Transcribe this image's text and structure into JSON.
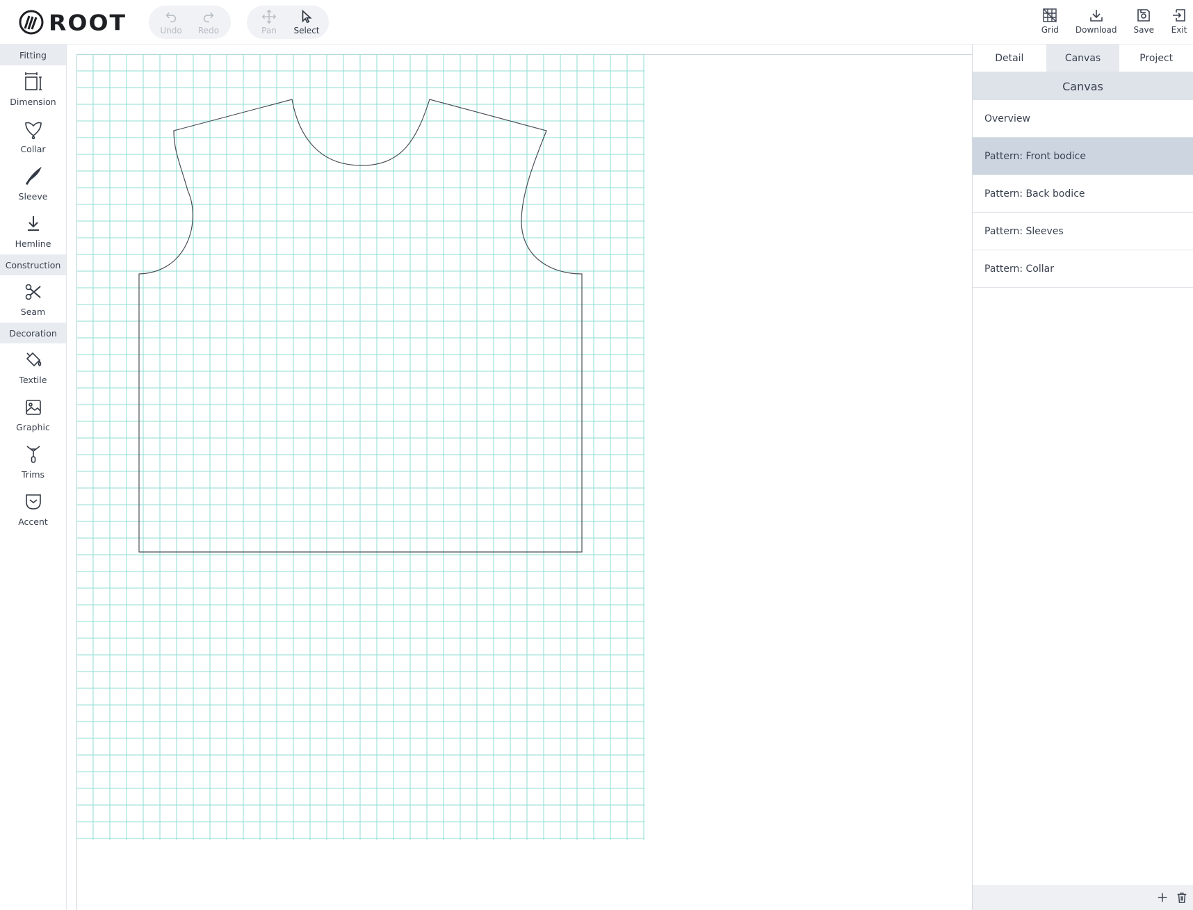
{
  "app": {
    "logo_text": "ROOT"
  },
  "toolbar": {
    "undo_label": "Undo",
    "redo_label": "Redo",
    "pan_label": "Pan",
    "select_label": "Select",
    "grid_label": "Grid",
    "download_label": "Download",
    "save_label": "Save",
    "exit_label": "Exit"
  },
  "sidebar": {
    "sections": [
      {
        "title": "Fitting",
        "items": [
          {
            "label": "Dimension",
            "icon": "dimension-icon"
          },
          {
            "label": "Collar",
            "icon": "collar-icon"
          },
          {
            "label": "Sleeve",
            "icon": "sleeve-icon"
          },
          {
            "label": "Hemline",
            "icon": "hemline-icon"
          }
        ]
      },
      {
        "title": "Construction",
        "items": [
          {
            "label": "Seam",
            "icon": "scissors-icon"
          }
        ]
      },
      {
        "title": "Decoration",
        "items": [
          {
            "label": "Textile",
            "icon": "paint-bucket-icon"
          },
          {
            "label": "Graphic",
            "icon": "image-icon"
          },
          {
            "label": "Trims",
            "icon": "zipper-icon"
          },
          {
            "label": "Accent",
            "icon": "pocket-icon"
          }
        ]
      }
    ]
  },
  "right_panel": {
    "tabs": [
      {
        "label": "Detail"
      },
      {
        "label": "Canvas"
      },
      {
        "label": "Project"
      }
    ],
    "active_tab": "Canvas",
    "title": "Canvas",
    "items": [
      {
        "label": "Overview"
      },
      {
        "label": "Pattern: Front bodice"
      },
      {
        "label": "Pattern: Back bodice"
      },
      {
        "label": "Pattern: Sleeves"
      },
      {
        "label": "Pattern: Collar"
      }
    ],
    "selected_item": "Pattern: Front bodice"
  },
  "colors": {
    "grid": "#8fdcd3",
    "pattern_stroke": "#4a4f57",
    "accent_selected": "#cdd6e0"
  }
}
